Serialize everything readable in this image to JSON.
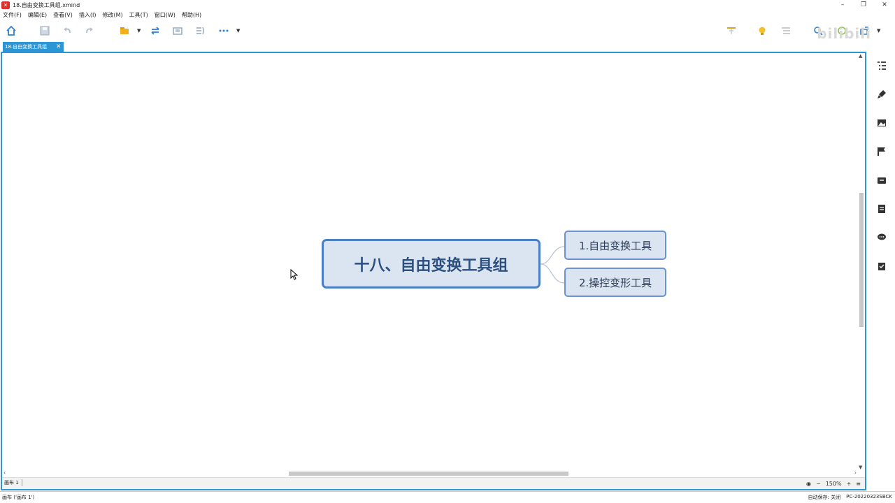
{
  "window": {
    "title": "18.自由变换工具组.xmind",
    "minimize": "–",
    "maximize": "❐",
    "close": "✕"
  },
  "menu": [
    "文件(F)",
    "编辑(E)",
    "查看(V)",
    "插入(I)",
    "修改(M)",
    "工具(T)",
    "窗口(W)",
    "帮助(H)"
  ],
  "tab": {
    "label": "18.自由变换工具组",
    "close": "✕"
  },
  "mindmap": {
    "central": "十八、自由变换工具组",
    "subtopics": [
      "1.自由变换工具",
      "2.操控变形工具"
    ],
    "colors": {
      "border": "#4a7fc8",
      "fill": "#dbe4f1",
      "text": "#2b4f7e"
    }
  },
  "sheetbar": {
    "sheet": "画布 1",
    "zoom": "150%",
    "zoom_out": "−",
    "zoom_in": "+"
  },
  "status": {
    "left": "画布 ('画布 1')",
    "autosave": "自动保存: 关闭",
    "computer": "PC-20220323SBCK"
  },
  "watermark": "bilibili",
  "accent": "#2b95d6"
}
